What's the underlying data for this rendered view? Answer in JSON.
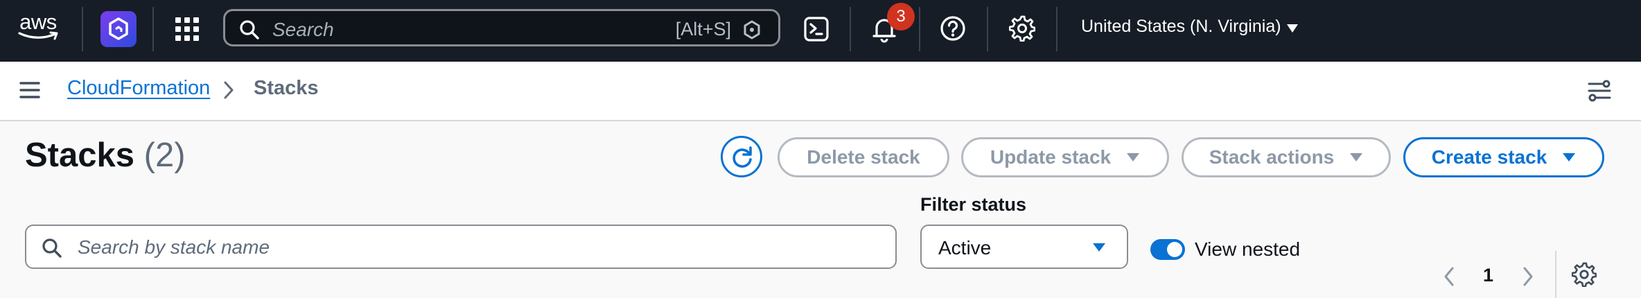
{
  "topnav": {
    "logo_text": "aws",
    "search_placeholder": "Search",
    "search_shortcut": "[Alt+S]",
    "notification_count": "3",
    "region": "United States (N. Virginia)"
  },
  "breadcrumb": {
    "service": "CloudFormation",
    "current": "Stacks"
  },
  "header": {
    "title": "Stacks",
    "count": "(2)"
  },
  "actions": {
    "delete": "Delete stack",
    "update": "Update stack",
    "stack_actions": "Stack actions",
    "create": "Create stack"
  },
  "filters": {
    "search_placeholder": "Search by stack name",
    "status_label": "Filter status",
    "status_value": "Active",
    "view_nested_label": "View nested",
    "view_nested_on": true
  },
  "pagination": {
    "current_page": "1"
  },
  "colors": {
    "nav_bg": "#161d26",
    "accent": "#0972d3",
    "badge": "#d0331f",
    "disabled_text": "#8d99a8"
  }
}
